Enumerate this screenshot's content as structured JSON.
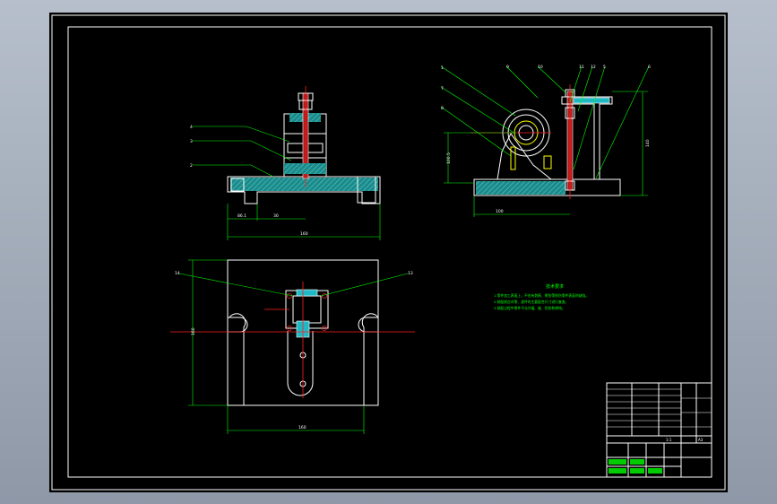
{
  "drawing": {
    "front_view": {
      "balloons": [
        "4",
        "3",
        "2"
      ],
      "dims": [
        "86.1",
        "30",
        "160"
      ]
    },
    "side_view": {
      "balloons": [
        "1",
        "7",
        "8",
        "9",
        "10",
        "11",
        "12",
        "5",
        "6"
      ],
      "dims": [
        "100.5",
        "100",
        "140"
      ]
    },
    "top_view": {
      "balloons": [
        "14",
        "13"
      ],
      "dims": [
        "160",
        "160"
      ]
    },
    "technical_requirements": {
      "title": "技术要求",
      "lines": [
        "1.零件加工表面上，不应有划痕、擦伤等损伤零件表面的缺陷。",
        "2.装配前应对零、部件的主要配合尺寸进行复查。",
        "3.装配过程中零件不允许磕、碰、划伤和锈蚀。"
      ]
    },
    "title_block": {
      "scale": "1:1",
      "sheet": "A3"
    }
  },
  "colors": {
    "outline": "#ffffff",
    "dimension": "#00ff00",
    "centerline": "#ff2020",
    "pin": "#1fb8c4"
  }
}
